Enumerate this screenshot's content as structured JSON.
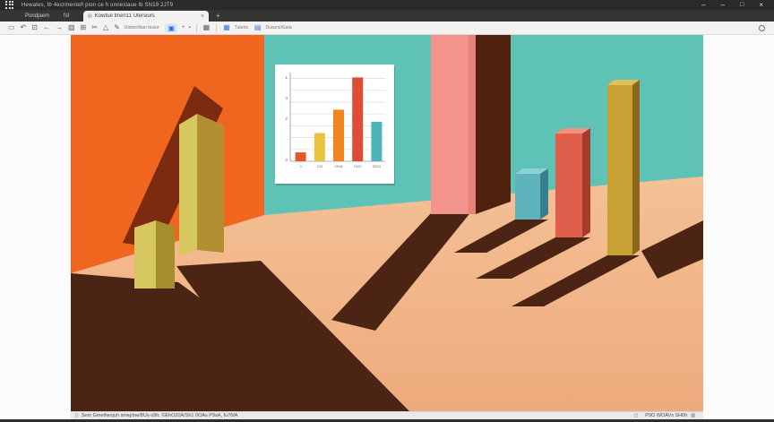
{
  "window": {
    "title": "Hewates, Ib 4ecrmentefl pion ce h unneslaue lb  SN19 2JT9",
    "controls": [
      {
        "name": "minimize-button",
        "glyph": "–"
      },
      {
        "name": "minimize-2-button",
        "glyph": "–"
      },
      {
        "name": "maximize-button",
        "glyph": "□"
      },
      {
        "name": "close-button",
        "glyph": "×"
      }
    ]
  },
  "menubar": {
    "items": [
      {
        "name": "menu-pondjaem",
        "label": "Pondjaem"
      },
      {
        "name": "menu-fsl",
        "label": "fsl"
      }
    ]
  },
  "tabbar": {
    "active_tab_label": "Kowtue tmen11 Utersiurs",
    "tab_close_glyph": "×",
    "new_tab_glyph": "+"
  },
  "toolbar": {
    "left_icons": [
      {
        "name": "select-tool-icon",
        "glyph": "▭"
      },
      {
        "name": "undo-icon",
        "glyph": "↶"
      },
      {
        "name": "share-icon",
        "glyph": "⊡"
      },
      {
        "name": "back-arrow-icon",
        "glyph": "←"
      },
      {
        "name": "forward-arrow-icon",
        "glyph": "→"
      },
      {
        "name": "image-icon",
        "glyph": "▨"
      },
      {
        "name": "table-icon",
        "glyph": "⊞"
      },
      {
        "name": "scissors-icon",
        "glyph": "✂"
      },
      {
        "name": "shapes-icon",
        "glyph": "△"
      },
      {
        "name": "pen-icon",
        "glyph": "✎"
      }
    ],
    "tool_label": "Utstse/iban tosiur",
    "active_tool_glyph": "▣",
    "plus_glyph": "+",
    "dot_glyph": "▪",
    "grid_icon_glyph": "▦",
    "views_icon_glyph": "▦",
    "views_label": "Tutens",
    "data_icon_glyph": "▤",
    "data_label": "Dusurs/iGata"
  },
  "statusbar": {
    "left_icon_glyph": "▯",
    "left_text": "Sem Gmelhesjuh smej/me/8Us-s9h. ©EhO20A/Sh1 0OAs P9sA, fu76fA",
    "right_copy_glyph": "▢",
    "right_text": "P9O WOAVs SH0h",
    "right_trash_glyph": "▥"
  },
  "canvas": {
    "description": "Surreal illustration: 3D bar-chart blocks standing in a room with orange and teal walls, long brown shadows on a peach floor, and a white poster showing a 2D bar chart"
  },
  "palette": {
    "orange_wall": "#f1661f",
    "teal_wall": "#5fc2b7",
    "floor_light": "#f7cda4",
    "floor_dark": "#eeab7d",
    "shadow_brown": "#4b2413",
    "wall_shadow_maroon": "#7c2b10",
    "pillar_pink": "#f2948c",
    "olive_light": "#d7c75f",
    "olive_dark": "#b29032",
    "mustard": "#c7a134",
    "salmon_block": "#e05f4c",
    "teal_block": "#5db4bd"
  },
  "chart_data": {
    "type": "bar",
    "title": "",
    "xlabel": "",
    "ylabel": "",
    "categories": [
      "0",
      "103",
      "2918",
      "2443",
      "2023"
    ],
    "values": [
      0.55,
      1.75,
      3.2,
      5.2,
      2.45
    ],
    "bar_colors": [
      "#e4572e",
      "#e8c33c",
      "#f28522",
      "#e04b35",
      "#4fb3ba"
    ],
    "y_tick_labels_top_to_bottom": [
      "1",
      "3",
      "2",
      "·",
      "0"
    ],
    "ylim": [
      0,
      5.5
    ],
    "grid": true,
    "gridline_count": 7,
    "legend_position": "none"
  }
}
